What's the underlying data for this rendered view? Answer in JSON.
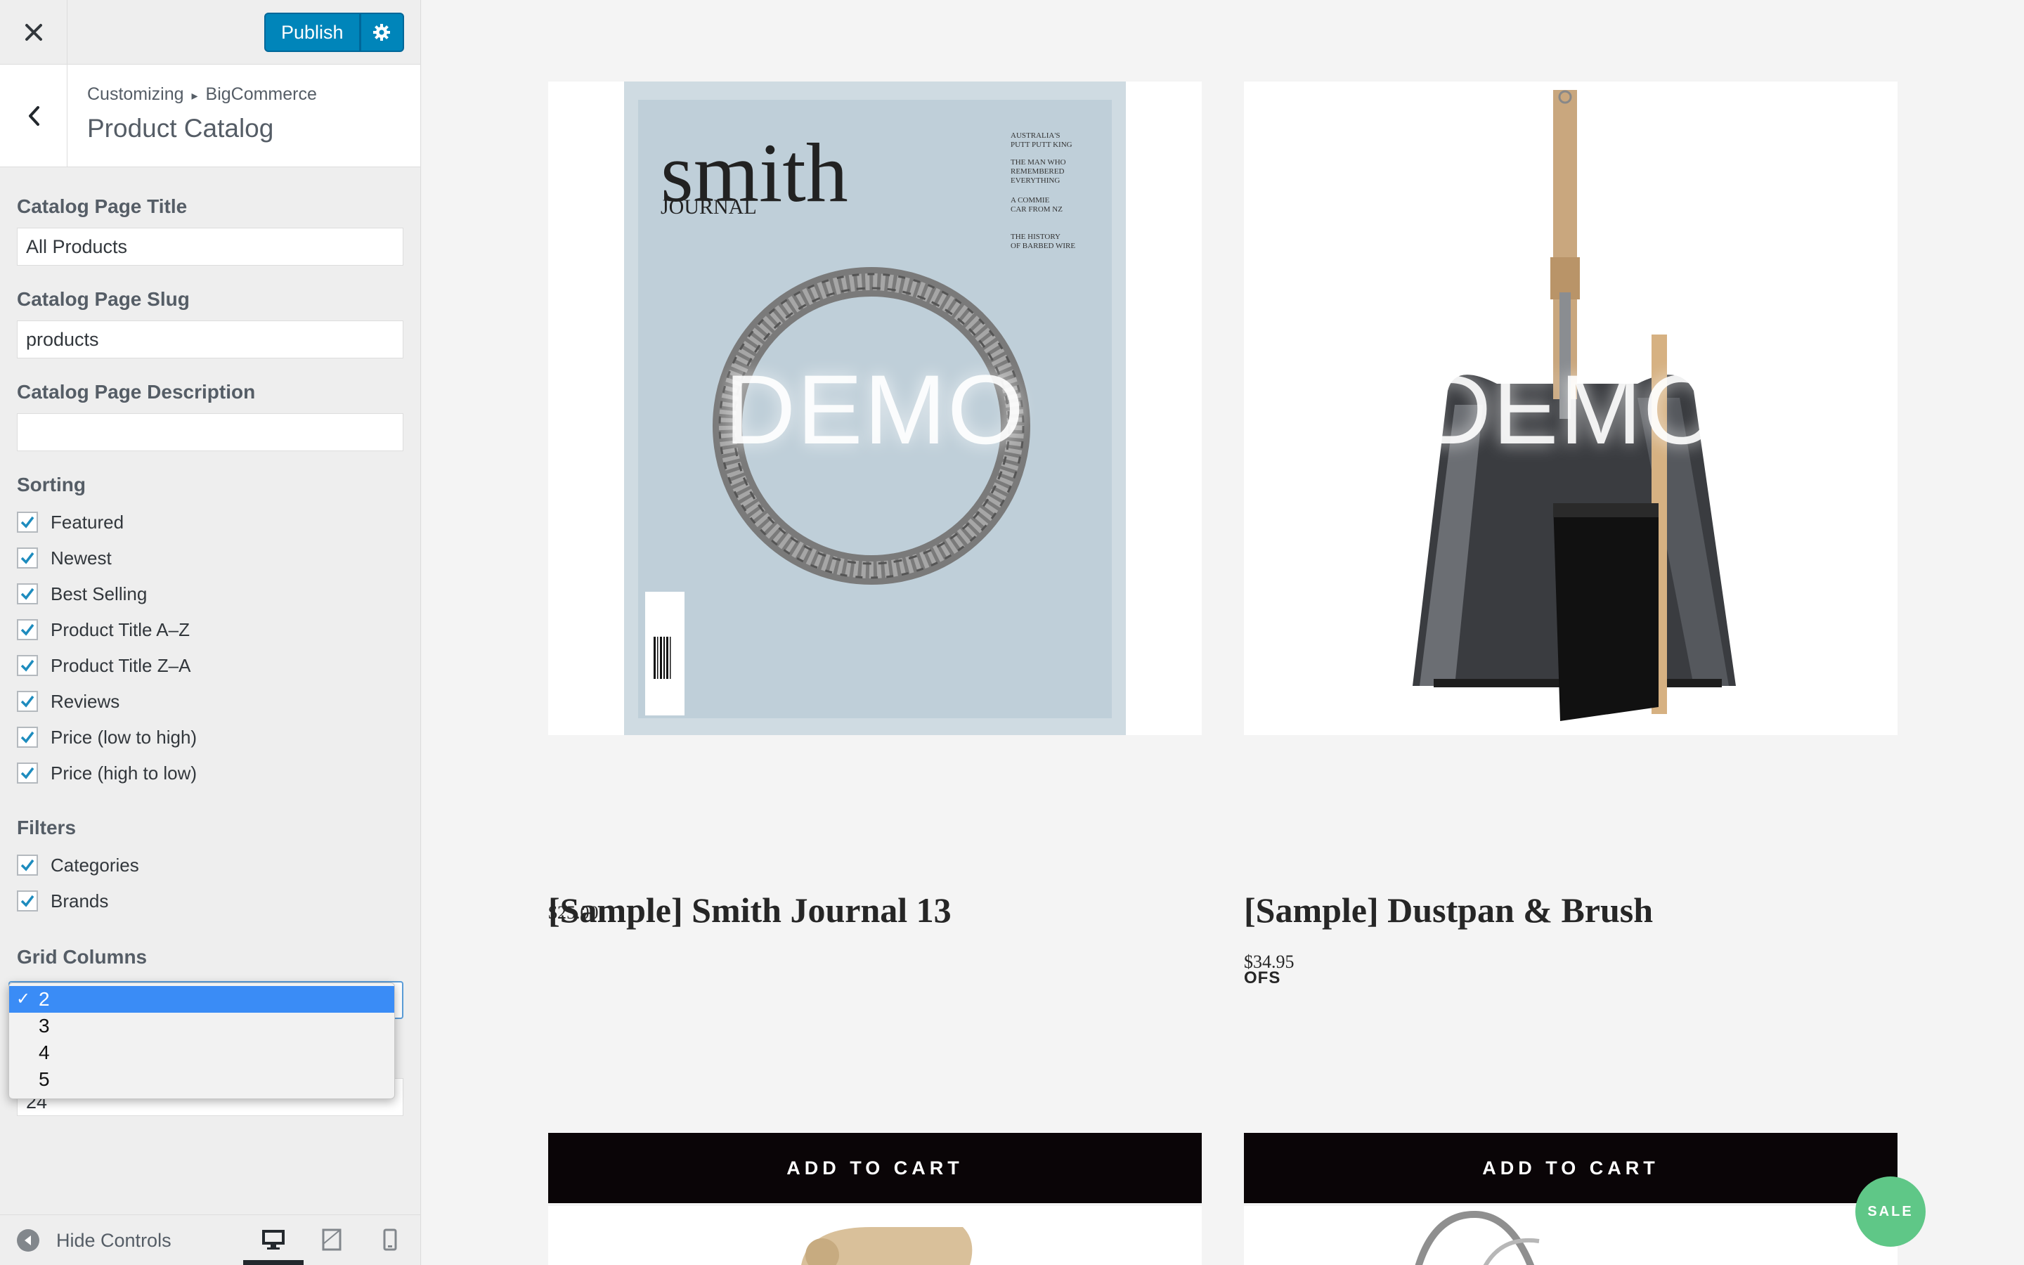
{
  "topbar": {
    "publish_label": "Publish",
    "close_icon": "close-icon",
    "gear_icon": "gear-icon"
  },
  "section": {
    "breadcrumb_prefix": "Customizing",
    "breadcrumb_separator": "▸",
    "breadcrumb_parent": "BigCommerce",
    "title": "Product Catalog"
  },
  "controls": {
    "catalog_title_label": "Catalog Page Title",
    "catalog_title_value": "All Products",
    "catalog_slug_label": "Catalog Page Slug",
    "catalog_slug_value": "products",
    "catalog_desc_label": "Catalog Page Description",
    "catalog_desc_value": "",
    "sorting_label": "Sorting",
    "sorting": [
      {
        "label": "Featured",
        "checked": true
      },
      {
        "label": "Newest",
        "checked": true
      },
      {
        "label": "Best Selling",
        "checked": true
      },
      {
        "label": "Product Title A–Z",
        "checked": true
      },
      {
        "label": "Product Title Z–A",
        "checked": true
      },
      {
        "label": "Reviews",
        "checked": true
      },
      {
        "label": "Price (low to high)",
        "checked": true
      },
      {
        "label": "Price (high to low)",
        "checked": true
      }
    ],
    "filters_label": "Filters",
    "filters": [
      {
        "label": "Categories",
        "checked": true
      },
      {
        "label": "Brands",
        "checked": true
      }
    ],
    "grid_columns_label": "Grid Columns",
    "grid_columns_selected": "2",
    "grid_columns_options": [
      "2",
      "3",
      "4",
      "5"
    ],
    "products_per_page_value": "24"
  },
  "footer": {
    "hide_controls_label": "Hide Controls",
    "devices": [
      "desktop-icon",
      "tablet-icon",
      "mobile-icon"
    ]
  },
  "preview": {
    "watermark": "DEMO",
    "products": [
      {
        "title": "[Sample] Smith Journal 13",
        "brand": "",
        "price": "$25.00",
        "button": "ADD TO CART"
      },
      {
        "title": "[Sample] Dustpan & Brush",
        "brand": "OFS",
        "price": "$34.95",
        "button": "ADD TO CART"
      }
    ],
    "sale_badge": "SALE",
    "magazine": {
      "masthead": "smith",
      "sub": "JOURNAL",
      "headlines": [
        "AUSTRALIA'S",
        "PUTT PUTT KING",
        "THE MAN WHO",
        "REMEMBERED",
        "EVERYTHING",
        "A COMMIE",
        "CAR FROM NZ",
        "THE HISTORY",
        "OF BARBED WIRE"
      ]
    }
  },
  "colors": {
    "accent": "#0085ba",
    "button_dark": "#0a0507",
    "sale_green": "#5fc787",
    "checkbox_check": "#1e8cbe"
  }
}
